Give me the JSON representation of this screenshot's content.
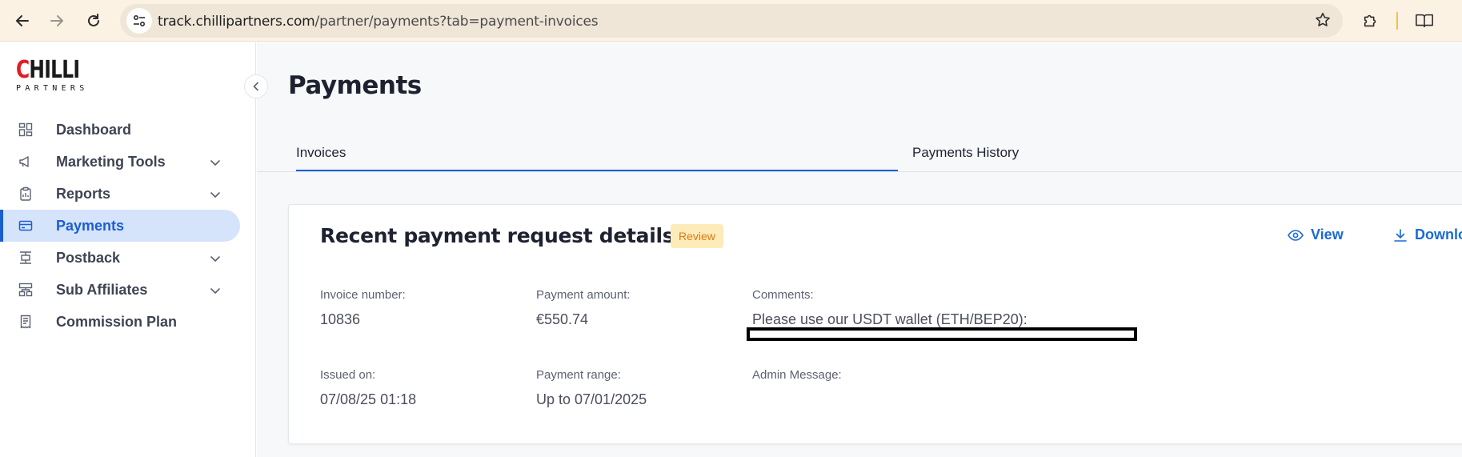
{
  "browser": {
    "url_host": "track.chillipartners.com",
    "url_path": "/partner/payments?tab=payment-invoices"
  },
  "logo": {
    "first_letter": "C",
    "rest": "HILLI",
    "sub": "PARTNERS"
  },
  "sidebar": {
    "items": [
      {
        "label": "Dashboard",
        "icon": "dashboard-icon",
        "expandable": false,
        "active": false
      },
      {
        "label": "Marketing Tools",
        "icon": "megaphone-icon",
        "expandable": true,
        "active": false
      },
      {
        "label": "Reports",
        "icon": "clipboard-icon",
        "expandable": true,
        "active": false
      },
      {
        "label": "Payments",
        "icon": "card-icon",
        "expandable": false,
        "active": true
      },
      {
        "label": "Postback",
        "icon": "postback-icon",
        "expandable": true,
        "active": false
      },
      {
        "label": "Sub Affiliates",
        "icon": "hierarchy-icon",
        "expandable": true,
        "active": false
      },
      {
        "label": "Commission Plan",
        "icon": "receipt-icon",
        "expandable": false,
        "active": false
      }
    ]
  },
  "main": {
    "title": "Payments",
    "tabs": [
      {
        "label": "Invoices",
        "active": true
      },
      {
        "label": "Payments History",
        "active": false
      }
    ],
    "card": {
      "title": "Recent payment request details",
      "badge": "Review",
      "actions": {
        "view": "View",
        "download": "Download"
      },
      "fields": {
        "invoice_number_label": "Invoice number:",
        "invoice_number": "10836",
        "payment_amount_label": "Payment amount:",
        "payment_amount": "€550.74",
        "comments_label": "Comments:",
        "comments": "Please use our USDT wallet (ETH/BEP20):",
        "issued_on_label": "Issued on:",
        "issued_on": "07/08/25 01:18",
        "payment_range_label": "Payment range:",
        "payment_range": "Up to 07/01/2025",
        "admin_message_label": "Admin Message:"
      }
    }
  },
  "colors": {
    "accent": "#1b5fcf",
    "active_bg": "#d5e3fb",
    "badge_bg": "#fdebb9",
    "badge_text": "#dd7a11",
    "logo_red": "#e41b23"
  }
}
